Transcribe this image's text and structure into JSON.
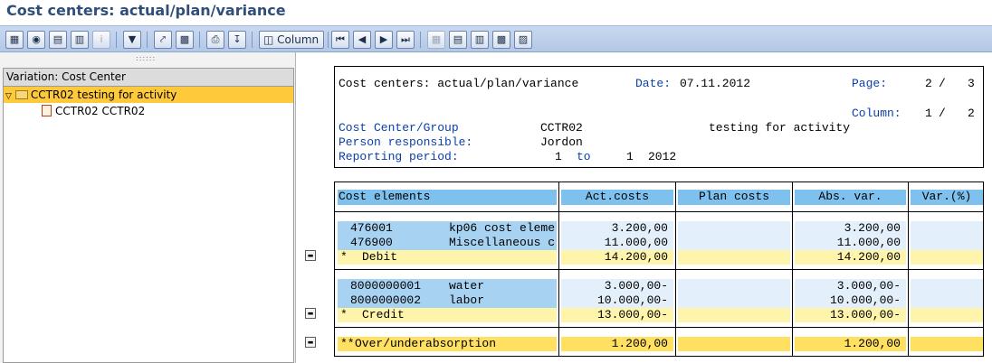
{
  "app_title": "Cost centers: actual/plan/variance",
  "toolbar": {
    "column_label": "Column"
  },
  "tree": {
    "header": "Variation: Cost Center",
    "root_label": "CCTR02 testing for activity",
    "child_label": "CCTR02 CCTR02"
  },
  "report": {
    "title": "Cost centers: actual/plan/variance",
    "date_label": "Date:",
    "date_value": "07.11.2012",
    "page_label": "Page:",
    "page_current": "2",
    "page_sep": "/",
    "page_total": "3",
    "column_label": "Column:",
    "column_current": "1",
    "column_sep": "/",
    "column_total": "2",
    "cc_group_label": "Cost Center/Group",
    "cc_group_value": "CCTR02",
    "cc_group_desc": "testing for activity",
    "person_label": "Person responsible:",
    "person_value": "Jordon",
    "period_label": "Reporting period:",
    "period_from": "1",
    "period_to_label": "to",
    "period_to": "1",
    "period_year": "2012"
  },
  "table": {
    "headers": {
      "cost_elements": "Cost elements",
      "act": "Act.costs",
      "plan": "Plan costs",
      "abs": "Abs. var.",
      "var": "Var.(%)"
    },
    "rows": [
      {
        "id": "476001",
        "desc": "kp06 cost eleme",
        "act": "3.200,00",
        "plan": "",
        "abs": "3.200,00",
        "var": ""
      },
      {
        "id": "476900",
        "desc": "Miscellaneous c",
        "act": "11.000,00",
        "plan": "",
        "abs": "11.000,00",
        "var": ""
      },
      {
        "id": "*",
        "desc": "Debit",
        "act": "14.200,00",
        "plan": "",
        "abs": "14.200,00",
        "var": ""
      },
      {
        "id": "8000000001",
        "desc": "water",
        "act": "3.000,00-",
        "plan": "",
        "abs": "3.000,00-",
        "var": ""
      },
      {
        "id": "8000000002",
        "desc": "labor",
        "act": "10.000,00-",
        "plan": "",
        "abs": "10.000,00-",
        "var": ""
      },
      {
        "id": "*",
        "desc": "Credit",
        "act": "13.000,00-",
        "plan": "",
        "abs": "13.000,00-",
        "var": ""
      },
      {
        "id": "**",
        "desc": "Over/underabsorption",
        "act": "1.200,00",
        "plan": "",
        "abs": "1.200,00",
        "var": ""
      }
    ]
  }
}
